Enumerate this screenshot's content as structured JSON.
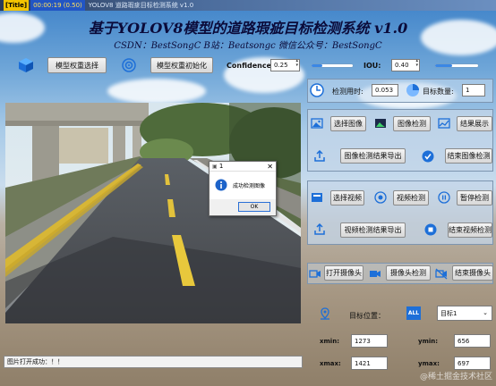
{
  "titlebar": {
    "badge": "[Title]",
    "clock": "00:00:19 (0.50)",
    "text": "YOLOV8 道路瑕疵目标检测系统 v1.0"
  },
  "header": {
    "title": "基于YOLOV8模型的道路瑕疵目标检测系统 v1.0",
    "subtitle": "CSDN：BestSongC   B站：Beatsongc   微信公众号：BestSongC"
  },
  "model": {
    "select_label": "模型权重选择",
    "init_label": "模型权重初始化",
    "confidence_label": "Confidence",
    "confidence_value": "0.25",
    "confidence_fraction": 0.25,
    "iou_label": "IOU:",
    "iou_value": "0.40",
    "iou_fraction": 0.4
  },
  "stats": {
    "time_label": "检测用时:",
    "time_value": "0.053",
    "count_label": "目标数量:",
    "count_value": "1"
  },
  "image_controls": {
    "select_image": "选择图像",
    "detect_image": "图像检测",
    "show_results": "结果展示",
    "export_results": "图像检测结果导出",
    "end_detect": "结束图像检测"
  },
  "video_controls": {
    "select_video": "选择视频",
    "detect_video": "视频检测",
    "pause_detect": "暂停检测",
    "export_results": "视频检测结果导出",
    "end_detect": "结束视频检测"
  },
  "camera_controls": {
    "open_camera": "打开摄像头",
    "detect_camera": "摄像头检测",
    "close_camera": "结束摄像头"
  },
  "target": {
    "position_label": "目标位置：",
    "all_badge": "ALL",
    "select_value": "目标1",
    "xmin_label": "xmin:",
    "xmin_value": "1273",
    "ymin_label": "ymin:",
    "ymin_value": "656",
    "xmax_label": "xmax:",
    "xmax_value": "1421",
    "ymax_label": "ymax:",
    "ymax_value": "697"
  },
  "dialog": {
    "title": "1",
    "message": "成功检测图像",
    "ok_label": "OK"
  },
  "status": {
    "text": "图片打开成功：！！"
  },
  "watermark": "@稀土掘金技术社区",
  "colors": {
    "accent": "#3a87e5",
    "title_text": "#0b0b3a"
  }
}
